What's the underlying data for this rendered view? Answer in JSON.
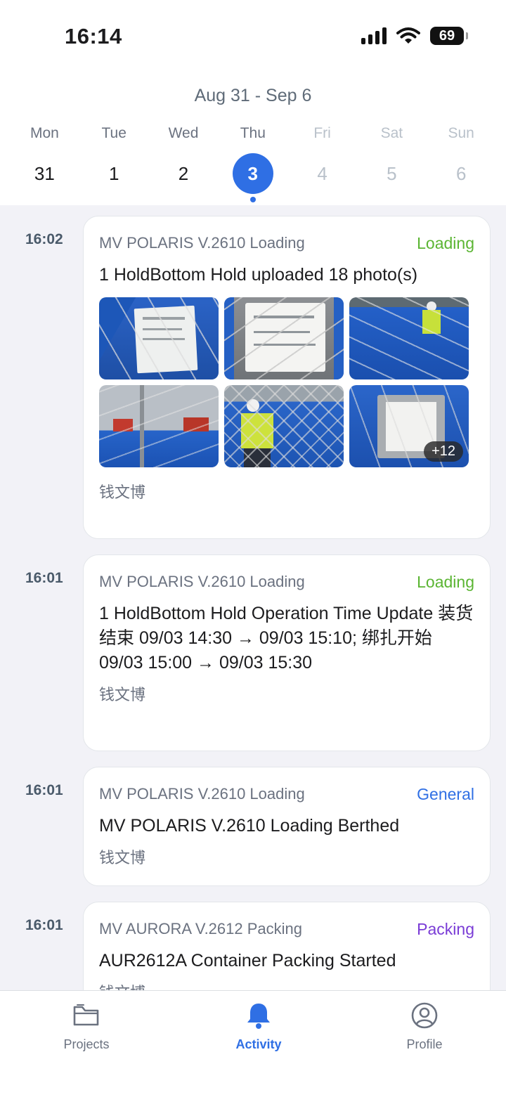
{
  "status": {
    "time": "16:14",
    "battery": "69"
  },
  "week": {
    "range": "Aug 31 - Sep 6",
    "days": [
      {
        "name": "Mon",
        "num": "31"
      },
      {
        "name": "Tue",
        "num": "1"
      },
      {
        "name": "Wed",
        "num": "2"
      },
      {
        "name": "Thu",
        "num": "3"
      },
      {
        "name": "Fri",
        "num": "4"
      },
      {
        "name": "Sat",
        "num": "5"
      },
      {
        "name": "Sun",
        "num": "6"
      }
    ]
  },
  "feed": [
    {
      "time": "16:02",
      "project": "MV POLARIS V.2610 Loading",
      "tag": "Loading",
      "title": "1 HoldBottom Hold uploaded 18 photo(s)",
      "more_photos": "+12",
      "author": "钱文博"
    },
    {
      "time": "16:01",
      "project": "MV POLARIS V.2610 Loading",
      "tag": "Loading",
      "title": "1 HoldBottom Hold Operation Time Update 装货结束 09/03 14:30 → 09/03 15:10; 绑扎开始 09/03 15:00 → 09/03 15:30",
      "author": "钱文博"
    },
    {
      "time": "16:01",
      "project": "MV POLARIS V.2610 Loading",
      "tag": "General",
      "title": "MV POLARIS V.2610 Loading Berthed",
      "author": "钱文博"
    },
    {
      "time": "16:01",
      "project": "MV AURORA V.2612 Packing",
      "tag": "Packing",
      "title": "AUR2612A Container Packing Started",
      "author": "钱文博"
    }
  ],
  "tabbar": {
    "projects": "Projects",
    "activity": "Activity",
    "profile": "Profile"
  },
  "colors": {
    "accent": "#2f6fe4",
    "loading": "#5bb533",
    "packing": "#7a3cd6"
  }
}
